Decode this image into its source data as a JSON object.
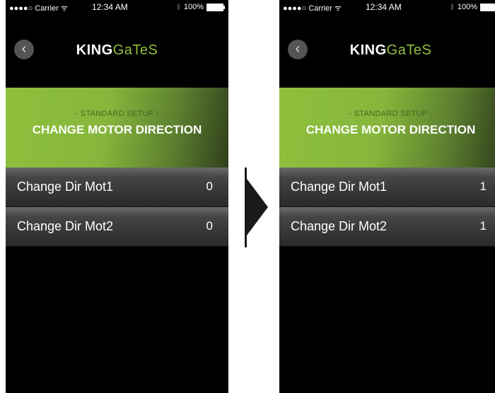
{
  "phones": [
    {
      "status": {
        "carrier": "●●●●○ Carrier ",
        "time": "12:34 AM",
        "battery": "100%"
      },
      "logo": {
        "brand_bold": "KING",
        "brand_light": "GaTeS"
      },
      "banner": {
        "subtitle": "- STANDARD SETUP -",
        "title": "CHANGE MOTOR DIRECTION"
      },
      "rows": [
        {
          "label": "Change Dir Mot1",
          "value": "0"
        },
        {
          "label": "Change Dir Mot2",
          "value": "0"
        }
      ]
    },
    {
      "status": {
        "carrier": "●●●●○ Carrier ",
        "time": "12:34 AM",
        "battery": "100%"
      },
      "logo": {
        "brand_bold": "KING",
        "brand_light": "GaTeS"
      },
      "banner": {
        "subtitle": "- STANDARD SETUP -",
        "title": "CHANGE MOTOR DIRECTION"
      },
      "rows": [
        {
          "label": "Change Dir Mot1",
          "value": "1"
        },
        {
          "label": "Change Dir Mot2",
          "value": "1"
        }
      ]
    }
  ],
  "colors": {
    "accent_green": "#8ec03d",
    "background": "#000000"
  },
  "icons": {
    "back": "chevron-left-icon",
    "transition": "arrow-right-icon",
    "wifi": "wifi-icon",
    "bluetooth": "bluetooth-icon",
    "battery": "battery-icon"
  }
}
